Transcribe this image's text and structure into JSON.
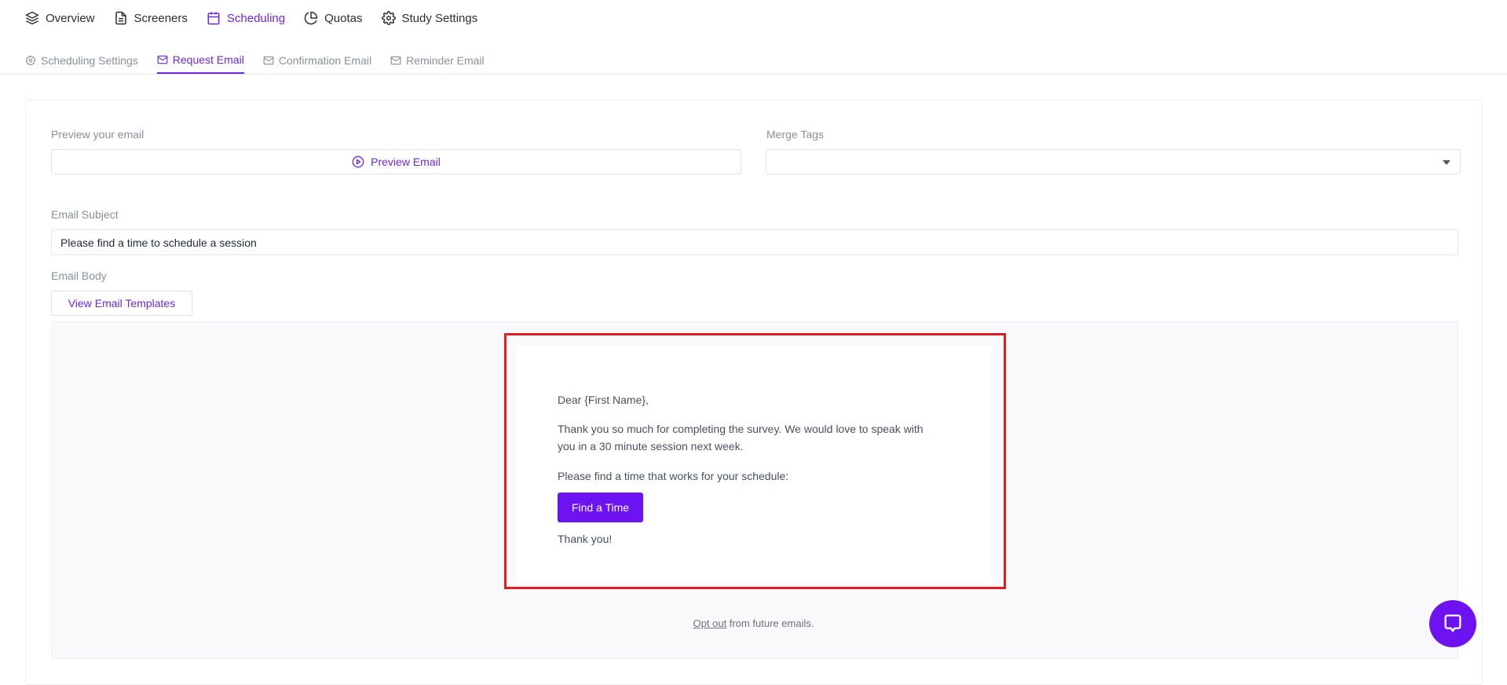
{
  "topnav": {
    "items": [
      {
        "label": "Overview",
        "icon": "layers-icon"
      },
      {
        "label": "Screeners",
        "icon": "document-icon"
      },
      {
        "label": "Scheduling",
        "icon": "calendar-icon",
        "active": true
      },
      {
        "label": "Quotas",
        "icon": "pie-chart-icon"
      },
      {
        "label": "Study Settings",
        "icon": "gear-icon"
      }
    ]
  },
  "subnav": {
    "tabs": [
      {
        "label": "Scheduling Settings",
        "icon": "gear-icon"
      },
      {
        "label": "Request Email",
        "icon": "mail-icon",
        "active": true
      },
      {
        "label": "Confirmation Email",
        "icon": "mail-icon"
      },
      {
        "label": "Reminder Email",
        "icon": "mail-icon"
      }
    ]
  },
  "form": {
    "preview_label": "Preview your email",
    "preview_button": "Preview Email",
    "merge_tags_label": "Merge Tags",
    "merge_tags_value": "",
    "subject_label": "Email Subject",
    "subject_value": "Please find a time to schedule a session",
    "body_label": "Email Body",
    "templates_button": "View Email Templates"
  },
  "email": {
    "greeting": "Dear {First Name},",
    "line1a": "Thank you so much for completing the survey. We would love to speak with",
    "line1b": "you in a 30 minute session next week.",
    "line2": "Please find a time that works for your schedule:",
    "cta": "Find a Time",
    "signoff": "Thank you!",
    "optout_link": "Opt out",
    "optout_text": " from future emails."
  },
  "colors": {
    "accent": "#6d28d9",
    "button": "#6d12f0",
    "highlight": "#e11d1d"
  }
}
